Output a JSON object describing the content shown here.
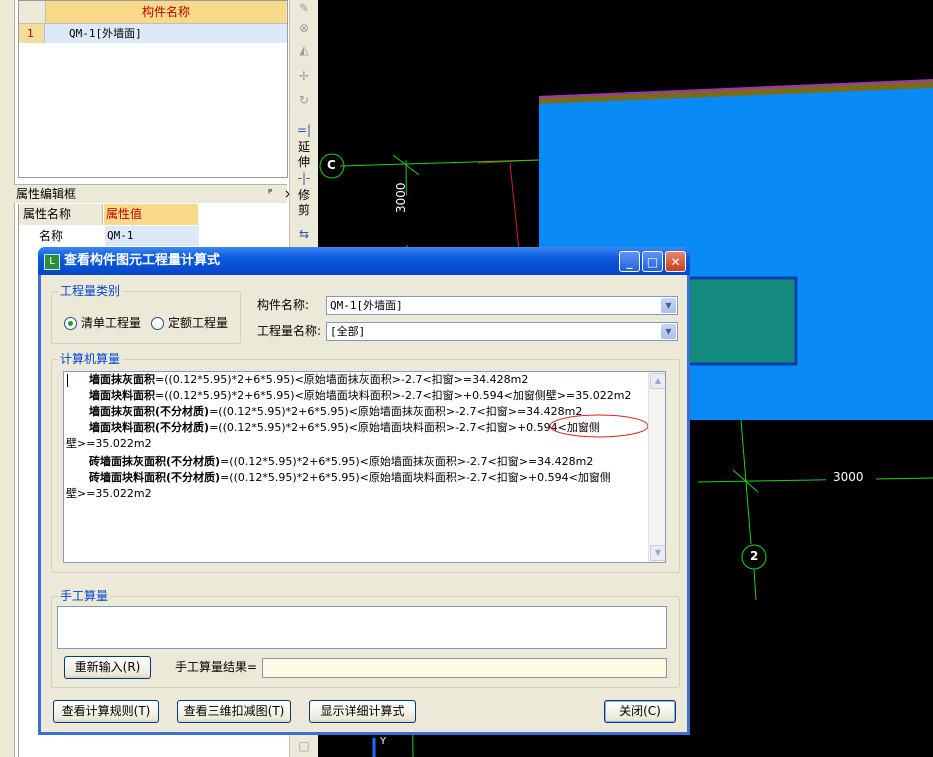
{
  "component_list": {
    "header": "构件名称",
    "rows": [
      {
        "num": "1",
        "name": "QM-1[外墙面]"
      }
    ]
  },
  "property_panel": {
    "title": "属性编辑框",
    "pin": "ᴾ",
    "close": "×",
    "col_name": "属性名称",
    "col_value": "属性值",
    "rows": [
      {
        "name": "名称",
        "value": "QM-1"
      }
    ]
  },
  "toolbar": {
    "extend_label": "延伸",
    "trim_label": "修剪"
  },
  "canvas": {
    "axis_c": "C",
    "axis_2": "2",
    "dim_vertical": "3000",
    "dim_horizontal": "3000",
    "y_axis": "Y",
    "colors": {
      "wall_blue": "#0a8af5",
      "grid_green": "#1bd21b",
      "teal": "#128a7c"
    }
  },
  "dialog": {
    "title": "查看构件图元工程量计算式",
    "quantity_type_label": "工程量类别",
    "radio_list": "清单工程量",
    "radio_quota": "定额工程量",
    "component_name_label": "构件名称:",
    "component_name_value": "QM-1[外墙面]",
    "quantity_name_label": "工程量名称:",
    "quantity_name_value": "[全部]",
    "computer_calc_label": "计算机算量",
    "calc_lines": [
      {
        "bold": "墙面抹灰面积",
        "rest": "=((0.12*5.95)*2+6*5.95)<原始墙面抹灰面积>-2.7<扣窗>=34.428m2"
      },
      {
        "bold": "墙面块料面积",
        "rest": "=((0.12*5.95)*2+6*5.95)<原始墙面块料面积>-2.7<扣窗>+0.594<加窗侧壁>=35.022m2"
      },
      {
        "bold": "墙面抹灰面积(不分材质)",
        "rest": "=((0.12*5.95)*2+6*5.95)<原始墙面抹灰面积>-2.7<扣窗>=34.428m2"
      },
      {
        "bold": "墙面块料面积(不分材质)",
        "rest": "=((0.12*5.95)*2+6*5.95)<原始墙面块料面积>-2.7<扣窗>+0.594<加窗侧"
      },
      {
        "bold": "",
        "rest": "壁>=35.022m2"
      },
      {
        "bold": "砖墙面抹灰面积(不分材质)",
        "rest": "=((0.12*5.95)*2+6*5.95)<原始墙面抹灰面积>-2.7<扣窗>=34.428m2"
      },
      {
        "bold": "砖墙面块料面积(不分材质)",
        "rest": "=((0.12*5.95)*2+6*5.95)<原始墙面块料面积>-2.7<扣窗>+0.594<加窗侧"
      },
      {
        "bold": "",
        "rest": "壁>=35.022m2"
      }
    ],
    "manual_calc_label": "手工算量",
    "reenter_button": "重新输入(R)",
    "manual_result_label": "手工算量结果=",
    "manual_result_value": "",
    "btn_rules": "查看计算规则(T)",
    "btn_3d": "查看三维扣减图(T)",
    "btn_detail": "显示详细计算式",
    "btn_close": "关闭(C)"
  }
}
